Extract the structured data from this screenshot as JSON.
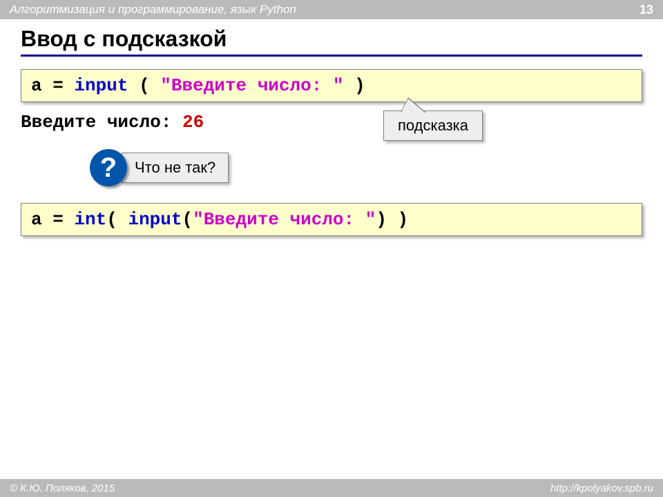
{
  "header": {
    "title": "Алгоритмизация и программирование, язык Python",
    "page_number": "13"
  },
  "slide": {
    "title": "Ввод с подсказкой"
  },
  "code1": {
    "var": "a ",
    "op": "= ",
    "func": "input ",
    "paren_open": "( ",
    "str": "\"Введите число: \"",
    "paren_close": " )"
  },
  "output": {
    "prompt": "Введите число: ",
    "value": "26"
  },
  "hint": {
    "label": "подсказка"
  },
  "question": {
    "mark": "?",
    "text": "Что не так?"
  },
  "code2": {
    "var": "a ",
    "op": "= ",
    "int_func": "int",
    "paren1_open": "( ",
    "input_func": "input",
    "paren2_open": "(",
    "str": "\"Введите число: \"",
    "paren2_close": ")",
    "paren1_close": " )"
  },
  "footer": {
    "copyright": "© К.Ю. Поляков, 2015",
    "url": "http://kpolyakov.spb.ru"
  }
}
